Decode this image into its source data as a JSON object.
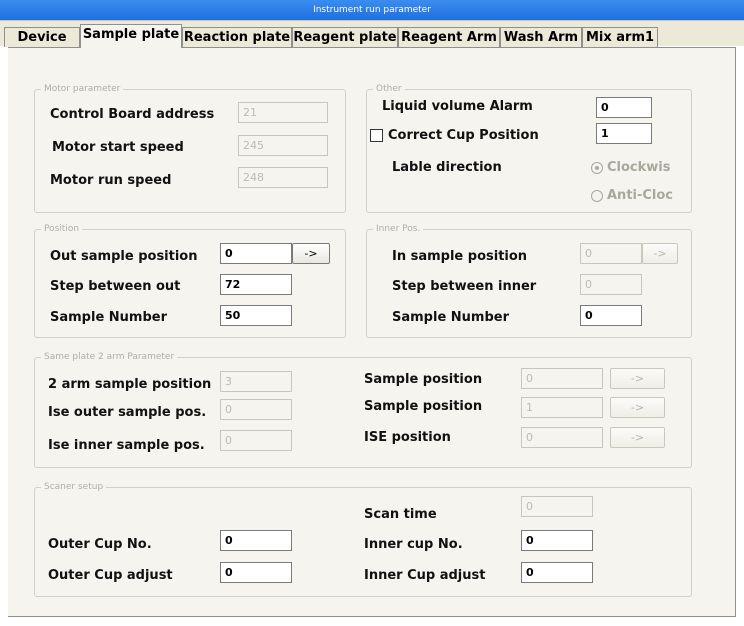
{
  "window": {
    "title": "Instrument run parameter"
  },
  "tabs": [
    {
      "label": "Device"
    },
    {
      "label": "Sample plate"
    },
    {
      "label": "Reaction plate"
    },
    {
      "label": "Reagent plate"
    },
    {
      "label": "Reagent Arm"
    },
    {
      "label": "Wash Arm"
    },
    {
      "label": "Mix arm1"
    }
  ],
  "motor": {
    "legend": "Motor parameter",
    "board_label": "Control Board address",
    "board_value": "21",
    "start_label": "Motor start speed",
    "start_value": "245",
    "run_label": "Motor run speed",
    "run_value": "248"
  },
  "other": {
    "legend": "Other",
    "alarm_label": "Liquid volume Alarm",
    "alarm_value": "0",
    "correct_label": "Correct Cup Position",
    "correct_value": "1",
    "direction_label": "Lable direction",
    "clockwise_label": "Clockwis",
    "anticlock_label": "Anti-Cloc"
  },
  "position": {
    "legend": "Position",
    "out_label": "Out sample position",
    "out_value": "0",
    "step_label": "Step between out",
    "step_value": "72",
    "num_label": "Sample Number",
    "num_value": "50",
    "arrow": "->"
  },
  "inner": {
    "legend": "Inner Pos.",
    "in_label": "In sample position",
    "in_value": "0",
    "step_label": "Step between inner",
    "step_value": "0",
    "num_label": "Sample Number",
    "num_value": "0",
    "arrow": "->"
  },
  "two_arm": {
    "legend": "Same plate 2 arm Parameter",
    "arm2_label": "2 arm sample position",
    "arm2_value": "3",
    "ise_outer_label": "Ise outer sample pos.",
    "ise_outer_value": "0",
    "ise_inner_label": "Ise inner sample pos.",
    "ise_inner_value": "0",
    "sp1_label": "Sample position",
    "sp1_value": "0",
    "sp2_label": "Sample position",
    "sp2_value": "1",
    "ise_label": "ISE position",
    "ise_value": "0",
    "arrow": "->"
  },
  "scanner": {
    "legend": "Scaner setup",
    "scan_label": "Scan time",
    "scan_value": "0",
    "outer_no_label": "Outer Cup No.",
    "outer_no_value": "0",
    "outer_adj_label": "Outer Cup adjust",
    "outer_adj_value": "0",
    "inner_no_label": "Inner cup No.",
    "inner_no_value": "0",
    "inner_adj_label": "Inner Cup adjust",
    "inner_adj_value": "0"
  }
}
